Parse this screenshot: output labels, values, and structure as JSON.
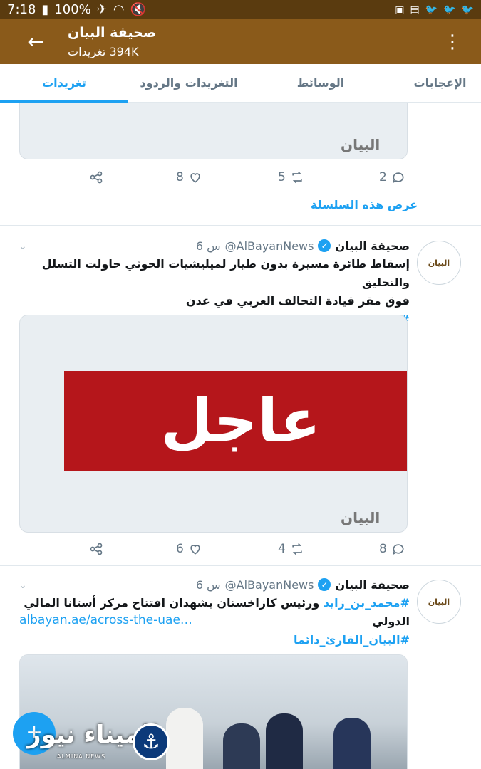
{
  "status_bar": {
    "time": "7:18",
    "battery": "100%",
    "right_icons": [
      "image-icon",
      "sim-icon",
      "twitter-icon",
      "twitter-icon",
      "twitter-icon"
    ]
  },
  "app_bar": {
    "title": "صحيفة البيان",
    "subtitle": "394K تغريدات"
  },
  "tabs": [
    {
      "label": "تغريدات",
      "active": true
    },
    {
      "label": "التغريدات والردود",
      "active": false
    },
    {
      "label": "الوسائط",
      "active": false
    },
    {
      "label": "الإعجابات",
      "active": false
    }
  ],
  "first_tweet": {
    "media_logo": "البيان",
    "replies": "2",
    "retweets": "5",
    "likes": "8",
    "show_thread": "عرض هذه السلسلة"
  },
  "tweets": [
    {
      "name": "صحيفة البيان",
      "handle": "@AlBayanNews",
      "time": "6 س",
      "avatar_text": "البيان",
      "text_line1": "إسقاط طائرة مسيرة بدون طيار لميليشيات الحوثي حاولت التسلل والتحليق",
      "text_line2": "فوق مقر قيادة التحالف العربي في عدن",
      "hashtag": "#البيان_القارئ_دائما",
      "media_breaking_text": "عاجل",
      "media_logo": "البيان",
      "replies": "8",
      "retweets": "4",
      "likes": "6"
    },
    {
      "name": "صحيفة البيان",
      "handle": "@AlBayanNews",
      "time": "6 س",
      "avatar_text": "البيان",
      "text_hashtag": "#محمد_بن_زايد",
      "text_rest": "ورئيس كازاخستان يشهدان افتتاح مركز أستانا المالي الدولي",
      "link": "albayan.ae/across-the-uae…",
      "hashtag": "#البيان_القارئ_دائما"
    }
  ],
  "watermark": {
    "text": "الميناء نيوز",
    "sub": "ALMINA NEWS"
  },
  "colors": {
    "app_bar": "#8a5a1a",
    "status_bar": "#5a3b0f",
    "accent": "#1da1f2",
    "breaking_red": "#b5161b"
  }
}
